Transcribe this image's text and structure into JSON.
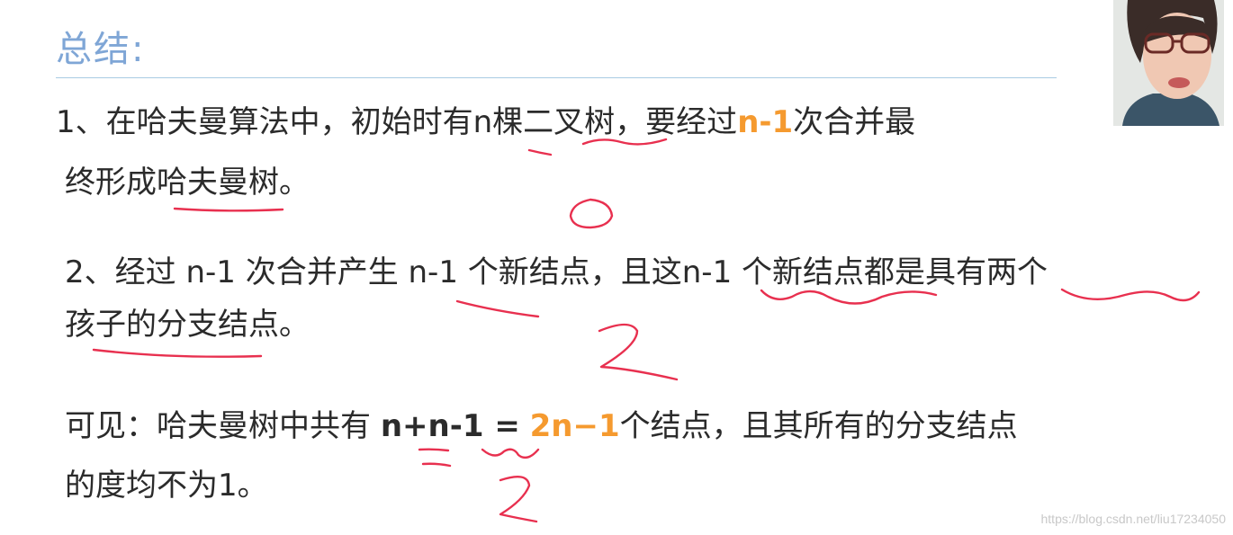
{
  "title": "总结:",
  "point1": {
    "part1": "1、在哈夫曼算法中，初始时有n棵二叉树，要经过",
    "highlight": "n-1",
    "part2": "次合并最",
    "line2": "终形成哈夫曼树。"
  },
  "point2": {
    "line1": "2、经过 n-1 次合并产生 n-1 个新结点，且这n-1 个新结点都是具有两个",
    "line2": "孩子的分支结点。"
  },
  "conclusion": {
    "prefix": "可见：哈夫曼树中共有",
    "formula": "n+n-1 =",
    "result": "2n−1",
    "suffix": "个结点，且其所有的分支结点",
    "line2": "的度均不为1。"
  },
  "watermark": "https://blog.csdn.net/liu17234050",
  "colors": {
    "title": "#7fa6d6",
    "highlight": "#f59a2f",
    "ink": "#e8304f"
  }
}
